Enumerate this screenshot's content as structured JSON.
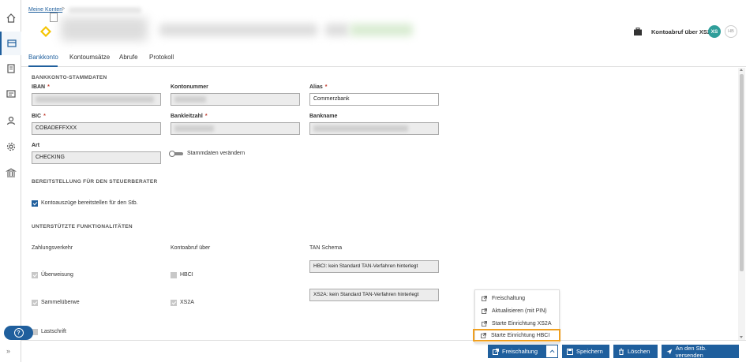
{
  "breadcrumb": {
    "root": "Meine Konten",
    "separator": ">"
  },
  "header": {
    "abruf_label": "Kontoabruf über XS2A",
    "pill_active": "XS",
    "pill_inactive": "HB"
  },
  "tabs": [
    {
      "label": "Bankkonto"
    },
    {
      "label": "Kontoumsätze"
    },
    {
      "label": "Abrufe"
    },
    {
      "label": "Protokoll"
    }
  ],
  "stammdaten": {
    "section_title": "BANKKONTO-STAMMDATEN",
    "iban_label": "IBAN",
    "kontonummer_label": "Kontonummer",
    "alias_label": "Alias",
    "alias_value": "Commerzbank",
    "bic_label": "BIC",
    "bic_value": "COBADEFFXXX",
    "blz_label": "Bankleitzahl",
    "bankname_label": "Bankname",
    "art_label": "Art",
    "art_value": "CHECKING",
    "required_mark": "*",
    "toggle_label": "Stammdaten verändern"
  },
  "bereitstellung": {
    "section_title": "BEREITSTELLUNG FÜR DEN STEUERBERATER",
    "checkbox_label": "Kontoauszüge bereitstellen für den Stb."
  },
  "funktionen": {
    "section_title": "UNTERSTÜTZTE FUNKTIONALITÄTEN",
    "col1": "Zahlungsverkehr",
    "col2": "Kontoabruf über",
    "col3": "TAN Schema",
    "ueberweisung": "Überweisung",
    "sammel": "Sammelüberwe",
    "lastschrift": "Lastschrift",
    "hbci": "HBCI",
    "xs2a": "XS2A",
    "tan_hbci": "HBCI: kein Standard TAN-Verfahren hinterlegt",
    "tan_xs2a": "XS2A: kein Standard TAN-Verfahren hinterlegt"
  },
  "dropdown": {
    "items": [
      {
        "label": "Freischaltung"
      },
      {
        "label": "Aktualisieren (mit PIN)"
      },
      {
        "label": "Starte Einrichtung XS2A"
      },
      {
        "label": "Starte Einrichtung HBCI"
      }
    ]
  },
  "footer": {
    "freischaltung": "Freischaltung",
    "speichern": "Speichern",
    "loeschen": "Löschen",
    "senden": "An den Stb. versenden"
  },
  "help": {
    "label": "?"
  },
  "colors": {
    "primary": "#1f5f9d",
    "highlight": "#f0a020",
    "logo": "#f5c400",
    "pill": "#2f9e9a"
  }
}
